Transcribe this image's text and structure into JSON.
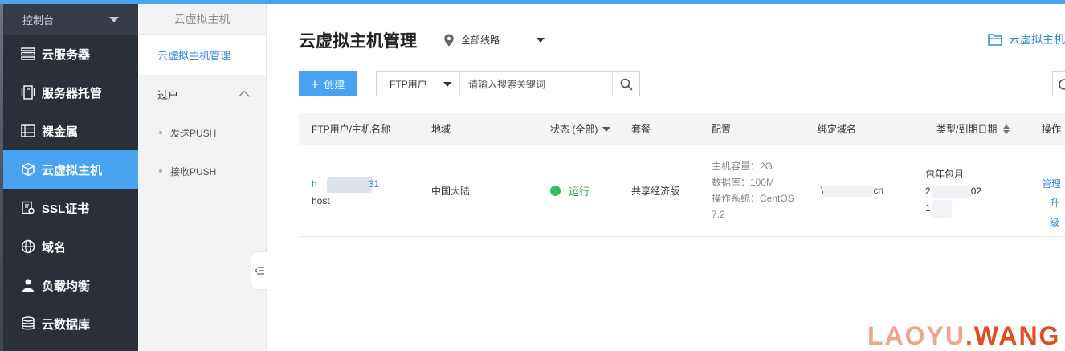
{
  "sidebar": {
    "header": "控制台",
    "items": [
      {
        "label": "云服务器",
        "icon": "server-list-icon",
        "active": false
      },
      {
        "label": "服务器托管",
        "icon": "hosting-icon",
        "active": false
      },
      {
        "label": "裸金属",
        "icon": "bare-metal-icon",
        "active": false
      },
      {
        "label": "云虚拟主机",
        "icon": "cube-icon",
        "active": true
      },
      {
        "label": "SSL证书",
        "icon": "certificate-icon",
        "active": false
      },
      {
        "label": "域名",
        "icon": "globe-icon",
        "active": false
      },
      {
        "label": "负载均衡",
        "icon": "load-balancer-icon",
        "active": false
      },
      {
        "label": "云数据库",
        "icon": "database-icon",
        "active": false
      }
    ]
  },
  "subnav": {
    "title": "云虚拟主机",
    "active_item": "云虚拟主机管理",
    "group": "过户",
    "sub_items": [
      "发送PUSH",
      "接收PUSH"
    ]
  },
  "main": {
    "title": "云虚拟主机管理",
    "region": "全部线路",
    "top_link": "云虚拟主机",
    "create_label": "创建",
    "search": {
      "type": "FTP用户",
      "placeholder": "请输入搜索关键词"
    },
    "table": {
      "headers": {
        "name": "FTP用户/主机名称",
        "region": "地域",
        "status": "状态 (全部)",
        "plan": "套餐",
        "config": "配置",
        "domain": "绑定域名",
        "type": "类型/到期日期",
        "actions": "操作"
      },
      "rows": [
        {
          "ftp_user": "h",
          "ftp_suffix": "31",
          "host_name": "host",
          "region": "中国大陆",
          "status": "运行",
          "plan": "共享经济版",
          "config": [
            "主机容量：2G",
            "数据库：100M",
            "操作系统：CentOS",
            "7.2"
          ],
          "domain_start": "\\",
          "domain_end": "cn",
          "type": "包年包月",
          "date_start": "2",
          "date_end": "02",
          "time_start": "1",
          "action_manage": "管理",
          "action_upgrade": "升级"
        }
      ]
    }
  },
  "watermark": {
    "part1": "LAOYU",
    "dot": ".",
    "part2": "WANG"
  }
}
